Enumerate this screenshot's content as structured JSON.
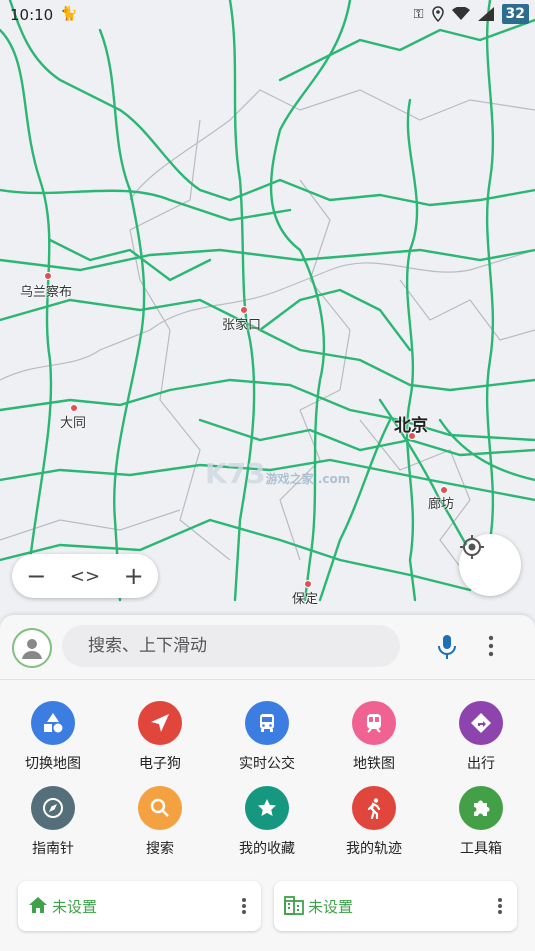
{
  "status_bar": {
    "time": "10:10",
    "battery_badge": "32"
  },
  "map": {
    "cities": [
      {
        "name": "乌兰察布",
        "big": false
      },
      {
        "name": "张家口",
        "big": false
      },
      {
        "name": "大同",
        "big": false
      },
      {
        "name": "北京",
        "big": true
      },
      {
        "name": "廊坊",
        "big": false
      },
      {
        "name": "保定",
        "big": false
      }
    ],
    "watermark": "K73",
    "watermark_sub": "游戏之家 .com"
  },
  "search": {
    "placeholder": "搜索、上下滑动"
  },
  "quick_actions": [
    {
      "label": "切换地图",
      "icon": "shapes-icon",
      "color": "#3b7de0"
    },
    {
      "label": "电子狗",
      "icon": "navigation-arrow-icon",
      "color": "#e0463c"
    },
    {
      "label": "实时公交",
      "icon": "bus-icon",
      "color": "#3b7de0"
    },
    {
      "label": "地铁图",
      "icon": "subway-icon",
      "color": "#f06292"
    },
    {
      "label": "出行",
      "icon": "directions-icon",
      "color": "#8e44ad"
    },
    {
      "label": "指南针",
      "icon": "compass-icon",
      "color": "#546e7a"
    },
    {
      "label": "搜索",
      "icon": "search-icon",
      "color": "#f4a142"
    },
    {
      "label": "我的收藏",
      "icon": "star-icon",
      "color": "#16977f"
    },
    {
      "label": "我的轨迹",
      "icon": "walking-icon",
      "color": "#e0463c"
    },
    {
      "label": "工具箱",
      "icon": "puzzle-icon",
      "color": "#43a047"
    }
  ],
  "shortcuts": {
    "home": {
      "label": "未设置",
      "icon": "home-icon"
    },
    "work": {
      "label": "未设置",
      "icon": "building-icon"
    }
  },
  "colors": {
    "road": "#2bb673",
    "accent_green": "#3fa24a"
  }
}
